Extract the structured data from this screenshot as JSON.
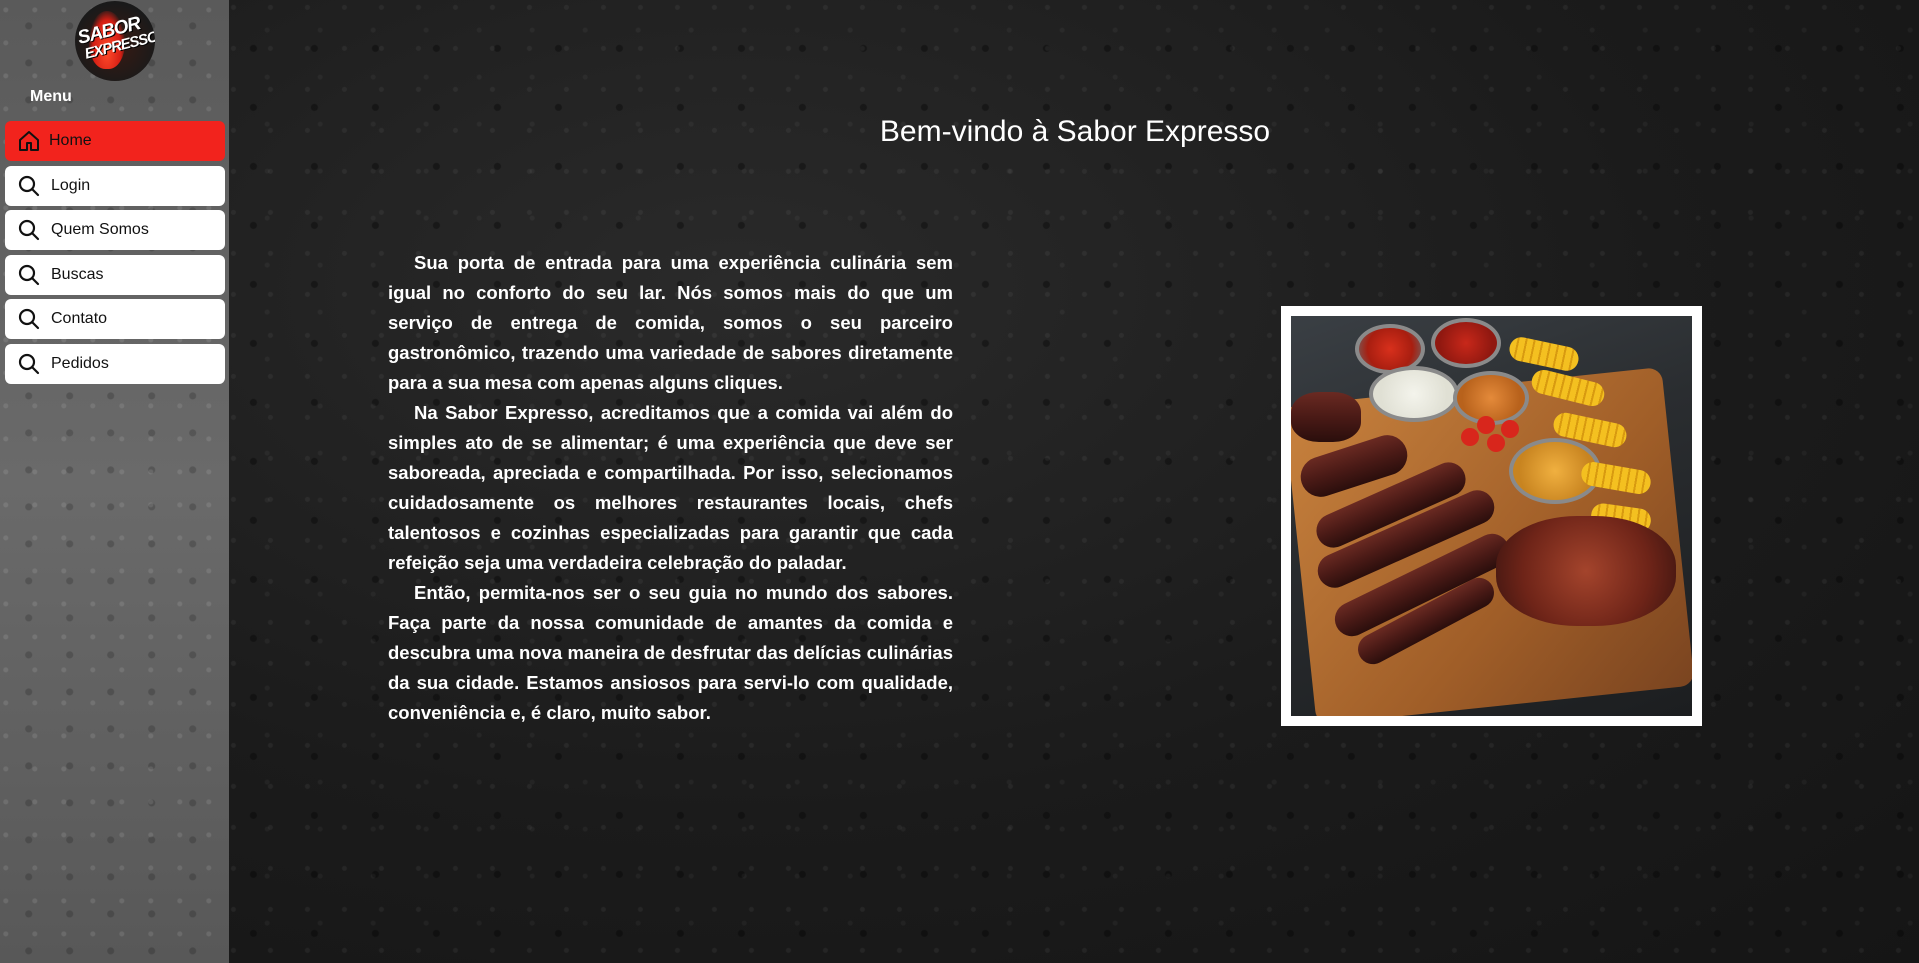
{
  "sidebar": {
    "logo_text_line1": "SABOR",
    "logo_text_line2": "EXPRESSO",
    "menu_label": "Menu",
    "items": [
      {
        "label": "Home",
        "icon": "home-icon",
        "active": true
      },
      {
        "label": "Login",
        "icon": "search-icon",
        "active": false
      },
      {
        "label": "Quem Somos",
        "icon": "search-icon",
        "active": false
      },
      {
        "label": "Buscas",
        "icon": "search-icon",
        "active": false
      },
      {
        "label": "Contato",
        "icon": "search-icon",
        "active": false
      },
      {
        "label": "Pedidos",
        "icon": "search-icon",
        "active": false
      }
    ]
  },
  "main": {
    "title": "Bem-vindo à Sabor Expresso",
    "paragraphs": [
      "Sua porta de entrada para uma experiência culinária sem igual no conforto do seu lar. Nós somos mais do que um serviço de entrega de comida, somos o seu parceiro gastronômico, trazendo uma variedade de sabores diretamente para a sua mesa com apenas alguns cliques.",
      "Na Sabor Expresso, acreditamos que a comida vai além do simples ato de se alimentar; é uma experiência que deve ser saboreada, apreciada e compartilhada. Por isso, selecionamos cuidadosamente os melhores restaurantes locais, chefs talentosos e cozinhas especializadas para garantir que cada refeição seja uma verdadeira celebração do paladar.",
      "Então, permita-nos ser o seu guia no mundo dos sabores. Faça parte da nossa comunidade de amantes da comida e descubra uma nova maneira de desfrutar das delícias culinárias da sua cidade. Estamos ansiosos para servi-lo com qualidade, conveniência e, é claro, muito sabor."
    ]
  },
  "colors": {
    "accent": "#f2231d",
    "sidebar_bg": "#5e5e5e",
    "main_bg": "#1d1d1d"
  }
}
